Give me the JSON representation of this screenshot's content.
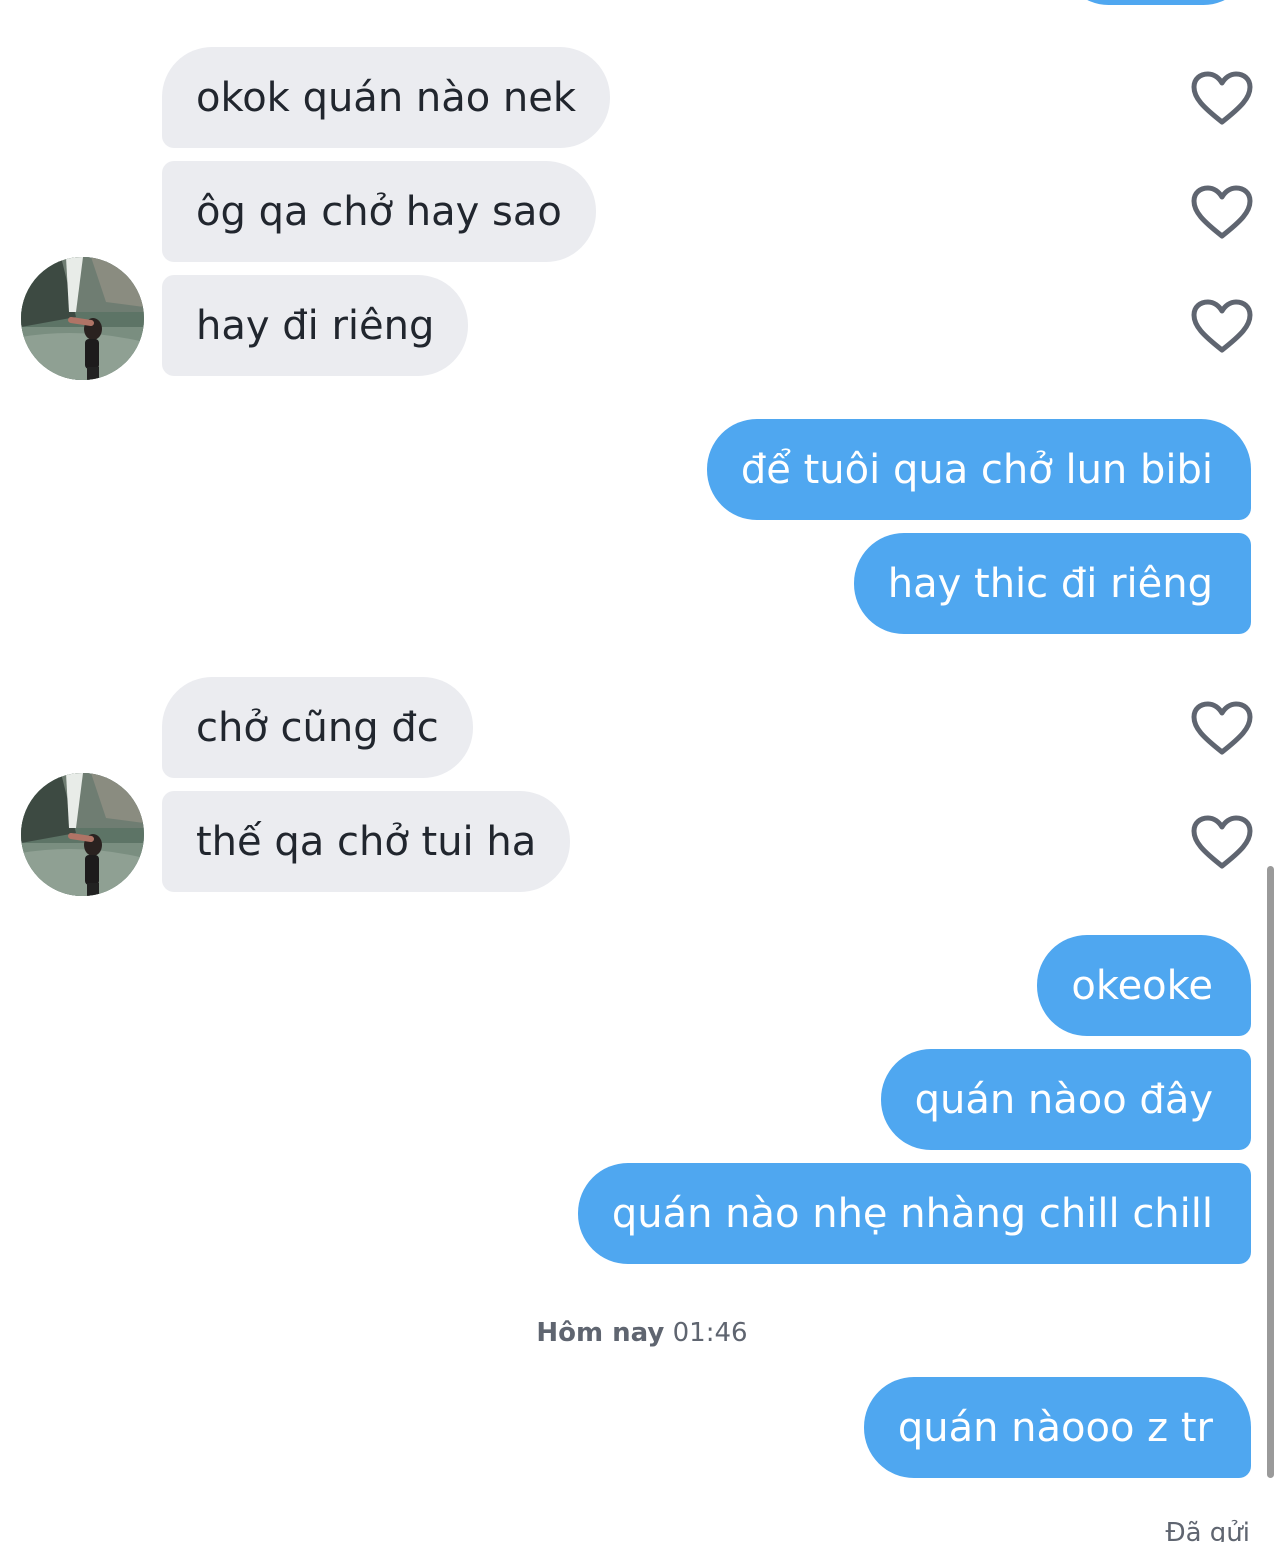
{
  "conversation": {
    "messages": [
      {
        "sender": "other",
        "text": "okok quán nào nek"
      },
      {
        "sender": "other",
        "text": "ôg qa chở hay sao"
      },
      {
        "sender": "other",
        "text": "hay đi riêng"
      },
      {
        "sender": "me",
        "text": "để tuôi qua chở lun bibi"
      },
      {
        "sender": "me",
        "text": "hay thic đi riêng"
      },
      {
        "sender": "other",
        "text": "chở cũng đc"
      },
      {
        "sender": "other",
        "text": "thế qa chở tui ha"
      },
      {
        "sender": "me",
        "text": "okeoke"
      },
      {
        "sender": "me",
        "text": "quán nàoo đây"
      },
      {
        "sender": "me",
        "text": "quán nào nhẹ nhàng chill chill"
      },
      {
        "sender": "me",
        "text": "quán nàooo z tr"
      }
    ],
    "timestamp": {
      "day": "Hôm nay",
      "time": "01:46"
    },
    "sent_status": "Đã gửi"
  },
  "icons": {
    "like": "heart-outline-icon",
    "avatar": "contact-avatar"
  },
  "colors": {
    "outgoing_bubble": "#4fa7f0",
    "incoming_bubble": "#ebecf0",
    "incoming_text": "#21262e",
    "heart_stroke": "#5f6570"
  }
}
